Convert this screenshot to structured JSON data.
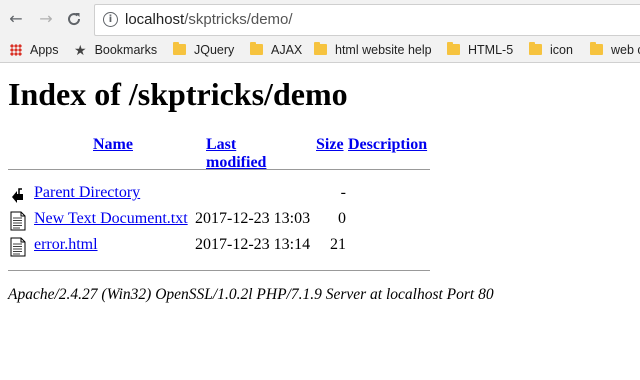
{
  "browser": {
    "url_host": "localhost",
    "url_path": "/skptricks/demo/",
    "back_glyph": "←",
    "forward_glyph": "→",
    "reload_glyph": "C"
  },
  "bookmarks": [
    {
      "label": "Apps",
      "icon": "apps-icon"
    },
    {
      "label": "Bookmarks",
      "icon": "star-icon"
    },
    {
      "label": "JQuery",
      "icon": "folder-icon"
    },
    {
      "label": "AJAX",
      "icon": "folder-icon"
    },
    {
      "label": "html website help",
      "icon": "folder-icon"
    },
    {
      "label": "HTML-5",
      "icon": "folder-icon"
    },
    {
      "label": "icon",
      "icon": "folder-icon"
    },
    {
      "label": "web c",
      "icon": "folder-icon"
    }
  ],
  "page": {
    "title": "Index of /skptricks/demo",
    "columns": {
      "name": "Name",
      "modified": "Last modified",
      "size": "Size",
      "description": "Description"
    },
    "rows": [
      {
        "name": "Parent Directory",
        "modified": "",
        "size": "-",
        "icon": "back-folder-icon"
      },
      {
        "name": "New Text Document.txt",
        "modified": "2017-12-23 13:03",
        "size": "0",
        "icon": "text-file-icon"
      },
      {
        "name": "error.html",
        "modified": "2017-12-23 13:14",
        "size": "21",
        "icon": "text-file-icon"
      }
    ],
    "footer": "Apache/2.4.27 (Win32) OpenSSL/1.0.2l PHP/7.1.9 Server at localhost Port 80"
  }
}
